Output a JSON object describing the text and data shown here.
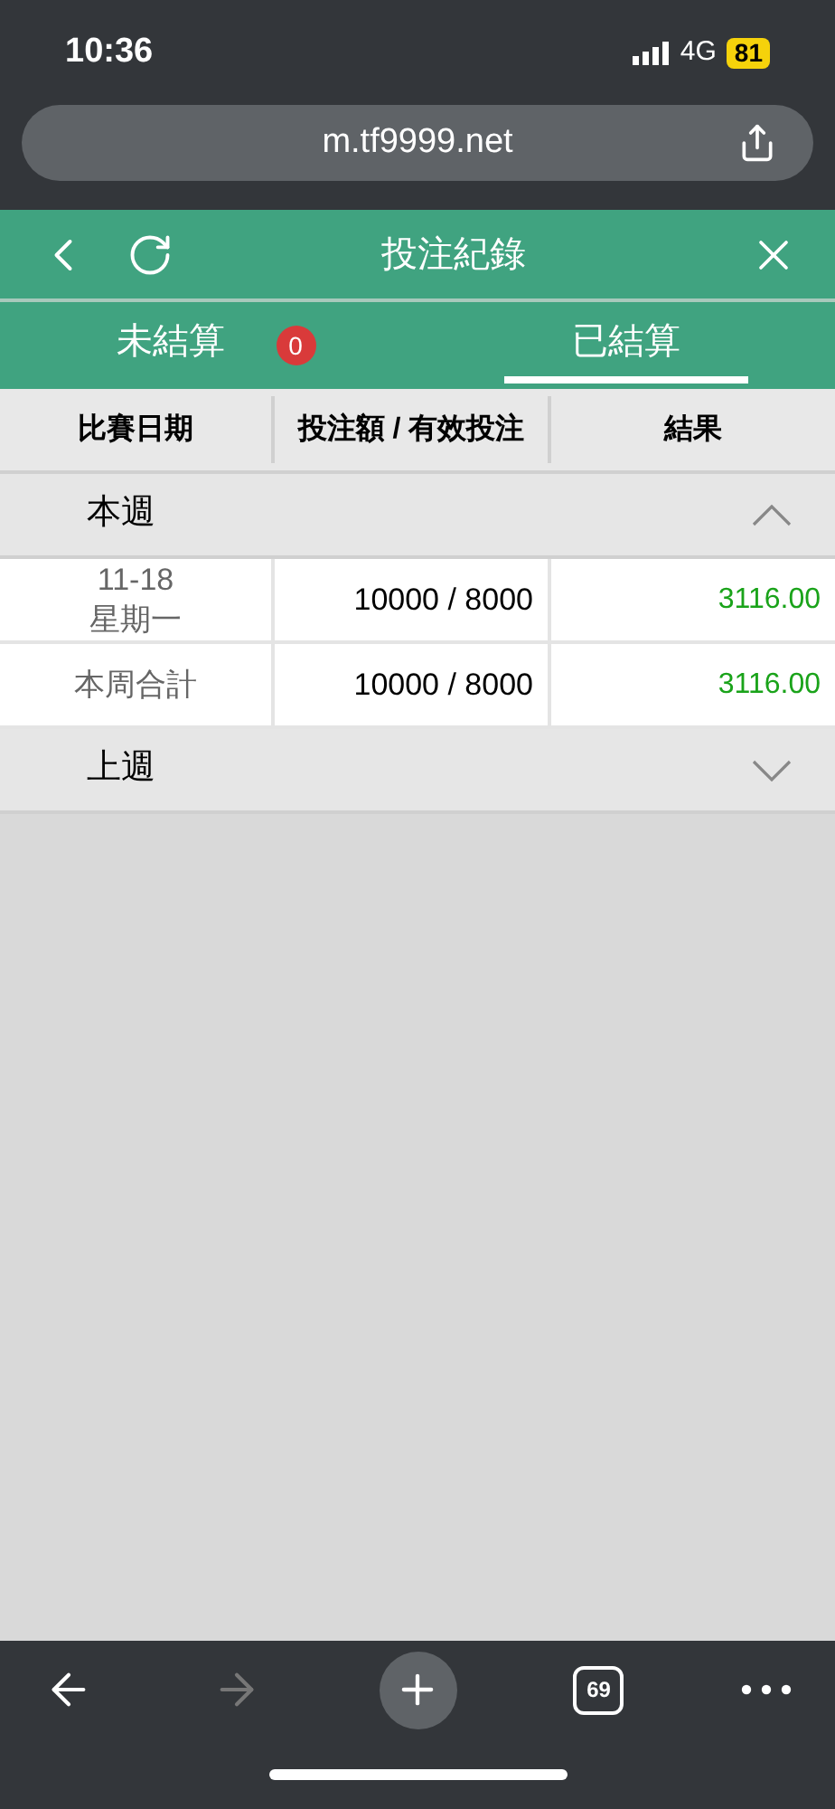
{
  "status_bar": {
    "time": "10:36",
    "network": "4G",
    "battery": "81"
  },
  "browser": {
    "url": "m.tf9999.net",
    "tab_count": "69",
    "forward_disabled": true
  },
  "header": {
    "title": "投注紀錄"
  },
  "tabs": [
    {
      "label": "未結算",
      "selected": false,
      "badge": "0"
    },
    {
      "label": "已結算",
      "selected": true
    }
  ],
  "table": {
    "columns": [
      "比賽日期",
      "投注額 / 有效投注",
      "結果"
    ],
    "groups": [
      {
        "label": "本週",
        "expanded": true,
        "rows": [
          {
            "kind": "day",
            "date": "11-18",
            "weekday": "星期一",
            "amount": "10000 / 8000",
            "result": "3116.00"
          },
          {
            "kind": "total",
            "label": "本周合計",
            "amount": "10000 / 8000",
            "result": "3116.00"
          }
        ]
      },
      {
        "label": "上週",
        "expanded": false
      }
    ]
  }
}
